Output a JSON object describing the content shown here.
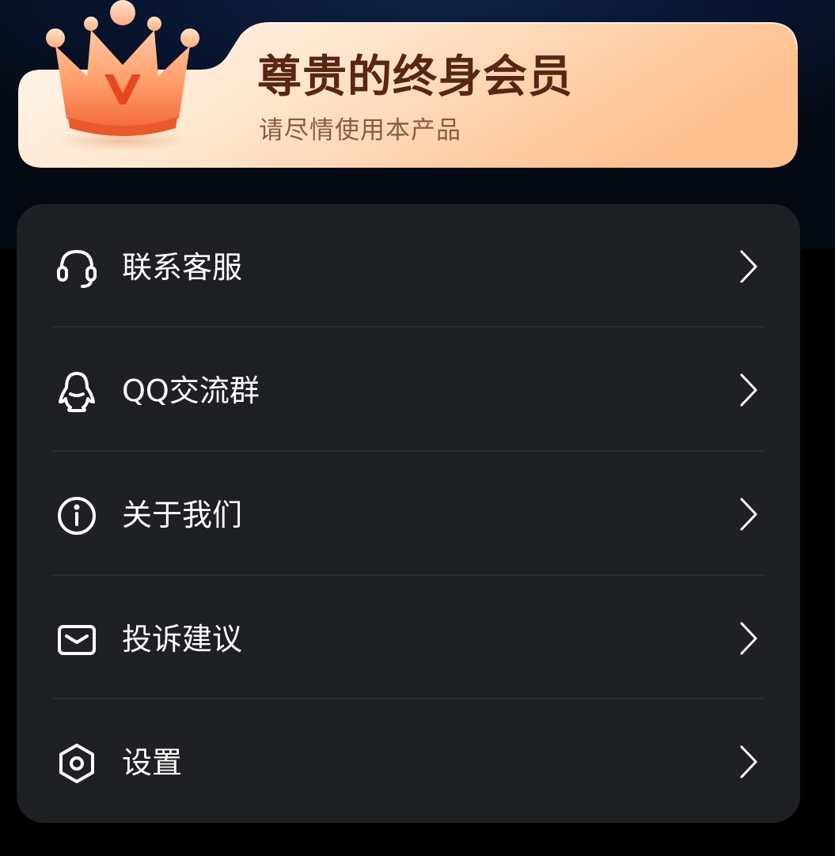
{
  "vip": {
    "title": "尊贵的终身会员",
    "subtitle": "请尽情使用本产品",
    "crown_icon": "crown-icon",
    "crown_letter": "V"
  },
  "menu": {
    "items": [
      {
        "label": "联系客服",
        "icon": "headset-icon"
      },
      {
        "label": "QQ交流群",
        "icon": "qq-penguin-icon"
      },
      {
        "label": "关于我们",
        "icon": "info-icon"
      },
      {
        "label": "投诉建议",
        "icon": "mail-icon"
      },
      {
        "label": "设置",
        "icon": "settings-hexagon-icon"
      }
    ]
  },
  "colors": {
    "background": "#000000",
    "card": "#1f2024",
    "banner_light": "#fdf1e4",
    "banner_dark": "#ffc596",
    "vip_title": "#5a2614",
    "vip_subtitle": "#8a5a45",
    "menu_text": "#ffffff"
  }
}
